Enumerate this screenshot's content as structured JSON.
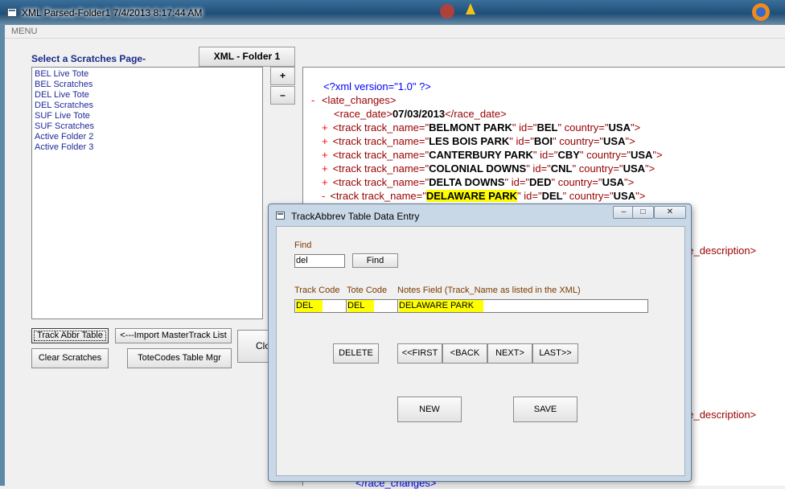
{
  "window": {
    "title": "XML Parsed-Folder1 7/4/2013 8:17:44 AM",
    "menu": "MENU"
  },
  "left_panel": {
    "select_label": "Select a Scratches Page-",
    "folder_button": "XML - Folder 1",
    "plus_button": "+",
    "minus_button": "–",
    "pages": [
      "BEL Live Tote",
      "BEL Scratches",
      "DEL Live Tote",
      "DEL Scratches",
      "SUF Live Tote",
      "SUF Scratches",
      "Active Folder 2",
      "Active Folder 3"
    ],
    "buttons": {
      "track_abbr_table": "Track Abbr Table",
      "import_master": "<---Import MasterTrack List",
      "clear_scratches": "Clear Scratches",
      "totecodes_mgr": "ToteCodes Table Mgr",
      "close_partial": "Clo"
    }
  },
  "xml": {
    "declaration": "<?xml version=\"1.0\" ?>",
    "root_open": "<late_changes>",
    "race_date_open": "<race_date>",
    "race_date_value": "07/03/2013",
    "race_date_close": "</race_date>",
    "expand_marker": "+",
    "collapse_marker": "-",
    "tracks": [
      {
        "name": "BELMONT PARK",
        "id": "BEL",
        "country": "USA",
        "marker": "+"
      },
      {
        "name": "LES BOIS PARK",
        "id": "BOI",
        "country": "USA",
        "marker": "+"
      },
      {
        "name": "CANTERBURY PARK",
        "id": "CBY",
        "country": "USA",
        "marker": "+"
      },
      {
        "name": "COLONIAL DOWNS",
        "id": "CNL",
        "country": "USA",
        "marker": "+"
      },
      {
        "name": "DELTA DOWNS",
        "id": "DED",
        "country": "USA",
        "marker": "+"
      },
      {
        "name": "DELAWARE PARK",
        "id": "DEL",
        "country": "USA",
        "marker": "-"
      }
    ],
    "right_fragment_1": "ge_description>",
    "right_fragment_2": "ge_description>",
    "root_close_partial": "</race_changes>"
  },
  "dialog": {
    "title": "TrackAbbrev Table Data Entry",
    "find_label": "Find",
    "find_value": "del",
    "find_button": "Find",
    "track_code_label": "Track Code",
    "tote_code_label": "Tote Code",
    "notes_label": "Notes Field (Track_Name as listed in the XML)",
    "track_code_value": "DEL",
    "tote_code_value": "DEL",
    "notes_value": "DELAWARE PARK",
    "delete_button": "DELETE",
    "first_button": "<<FIRST",
    "back_button": "<BACK",
    "next_button": "NEXT>",
    "last_button": "LAST>>",
    "new_button": "NEW",
    "save_button": "SAVE"
  }
}
